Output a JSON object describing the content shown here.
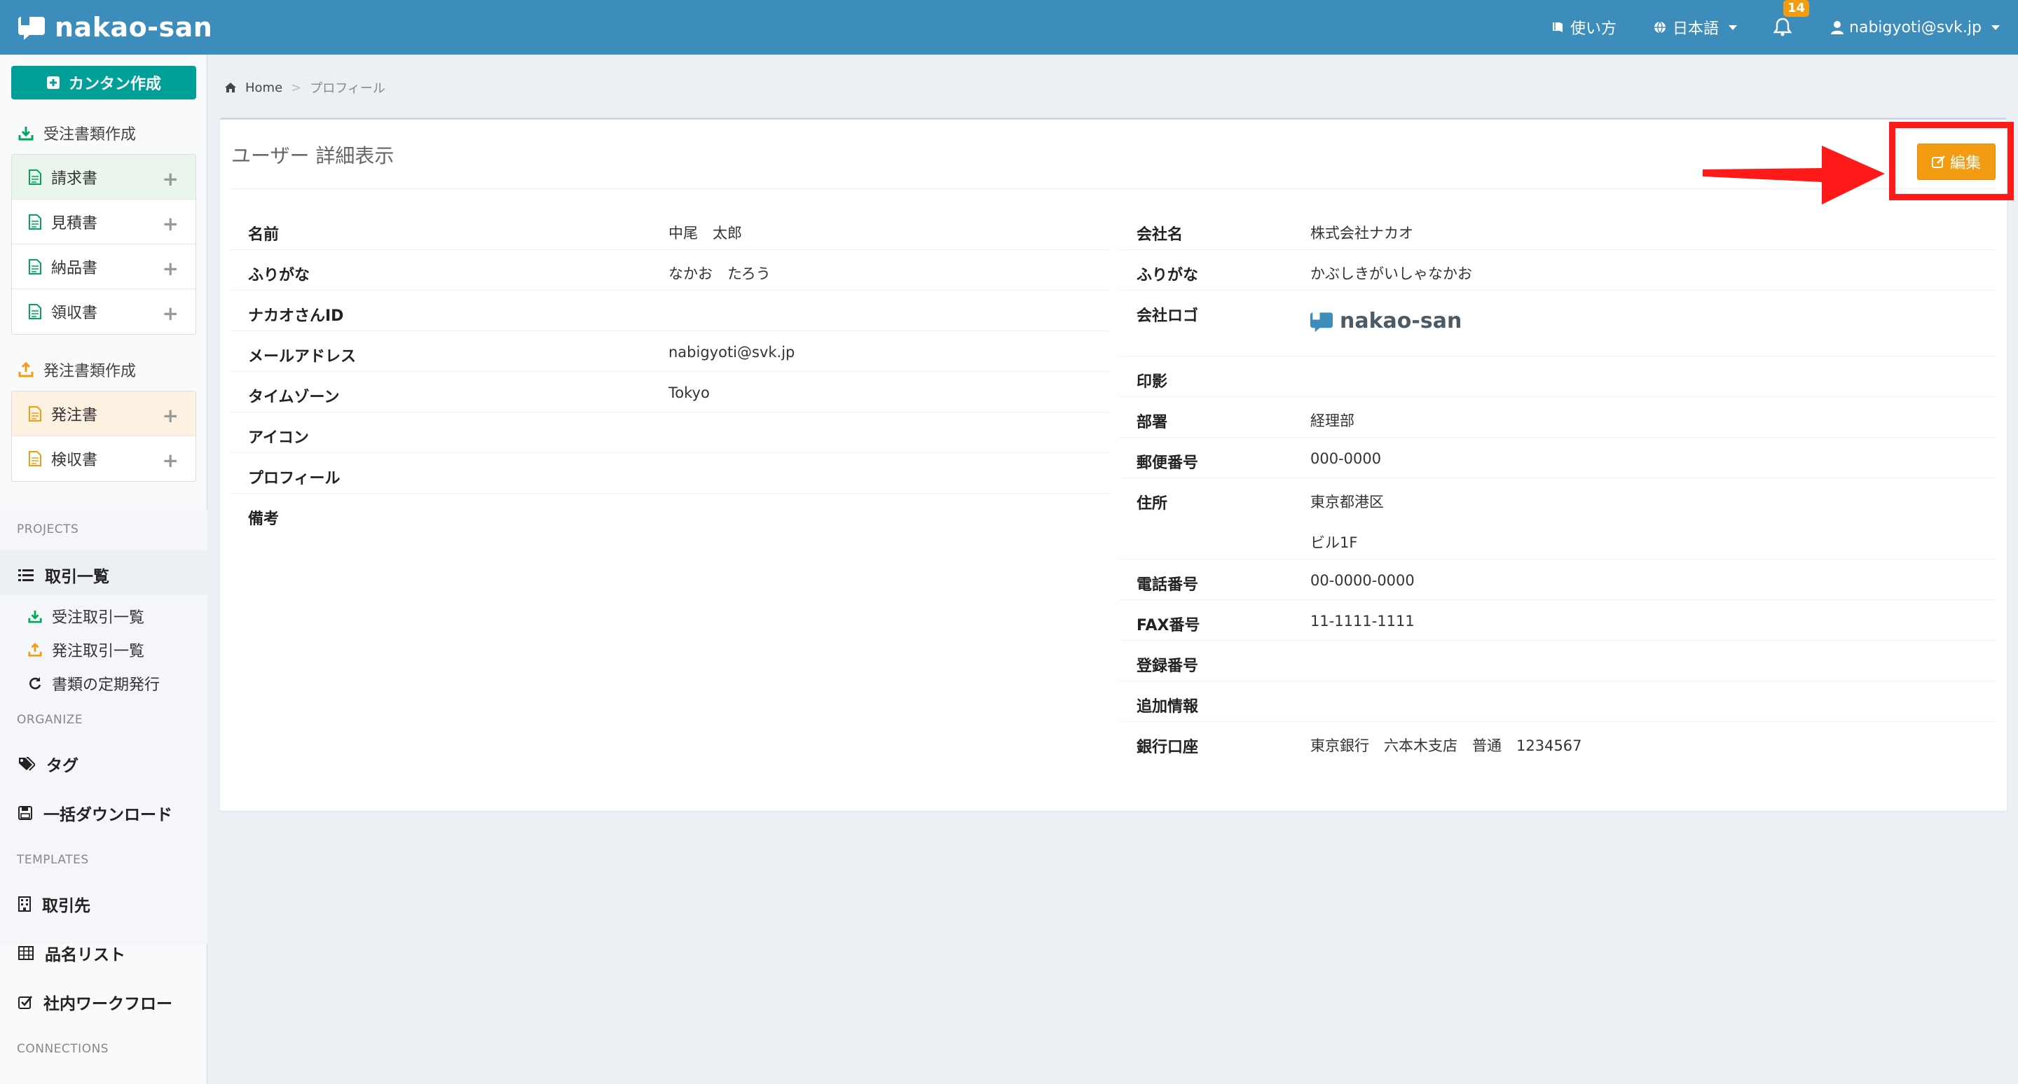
{
  "header": {
    "brand": "nakao-san",
    "nav": {
      "help": "使い方",
      "language": "日本語",
      "notification_count": "14",
      "user": "nabigyoti@svk.jp"
    }
  },
  "sidebar": {
    "quick_create": "カンタン作成",
    "received_section": "受注書類作成",
    "received_docs": [
      "請求書",
      "見積書",
      "納品書",
      "領収書"
    ],
    "order_section": "発注書類作成",
    "order_docs": [
      "発注書",
      "検収書"
    ],
    "projects_label": "PROJECTS",
    "deals": "取引一覧",
    "received_deals": "受注取引一覧",
    "order_deals": "発注取引一覧",
    "recurring": "書類の定期発行",
    "organize_label": "ORGANIZE",
    "tags": "タグ",
    "bulk_download": "一括ダウンロード",
    "templates_label": "TEMPLATES",
    "partners": "取引先",
    "item_list": "品名リスト",
    "workflow": "社内ワークフロー",
    "connections_label": "CONNECTIONS"
  },
  "breadcrumb": {
    "home": "Home",
    "separator": ">",
    "current": "プロフィール"
  },
  "panel": {
    "title": "ユーザー 詳細表示",
    "edit_button": "編集"
  },
  "user_fields": [
    {
      "label": "名前",
      "value": "中尾　太郎"
    },
    {
      "label": "ふりがな",
      "value": "なかお　たろう"
    },
    {
      "label": "ナカオさんID",
      "value": ""
    },
    {
      "label": "メールアドレス",
      "value": "nabigyoti@svk.jp"
    },
    {
      "label": "タイムゾーン",
      "value": "Tokyo"
    },
    {
      "label": "アイコン",
      "value": ""
    },
    {
      "label": "プロフィール",
      "value": ""
    },
    {
      "label": "備考",
      "value": ""
    }
  ],
  "company_fields": {
    "company_name": {
      "label": "会社名",
      "value": "株式会社ナカオ"
    },
    "furigana": {
      "label": "ふりがな",
      "value": "かぶしきがいしゃなかお"
    },
    "logo": {
      "label": "会社ロゴ",
      "value": "nakao-san"
    },
    "seal": {
      "label": "印影",
      "value": ""
    },
    "department": {
      "label": "部署",
      "value": "経理部"
    },
    "postal": {
      "label": "郵便番号",
      "value": "000-0000"
    },
    "address": {
      "label": "住所",
      "value": "東京都港区",
      "value2": "ビル1F"
    },
    "phone": {
      "label": "電話番号",
      "value": "00-0000-0000"
    },
    "fax": {
      "label": "FAX番号",
      "value": "11-1111-1111"
    },
    "registration": {
      "label": "登録番号",
      "value": ""
    },
    "extra": {
      "label": "追加情報",
      "value": ""
    },
    "bank": {
      "label": "銀行口座",
      "value": "東京銀行　六本木支店　普通　1234567"
    }
  },
  "colors": {
    "header": "#3c8dbc",
    "quick_button": "#00a098",
    "edit_button": "#f39c12",
    "highlight": "#ff1a1a"
  }
}
